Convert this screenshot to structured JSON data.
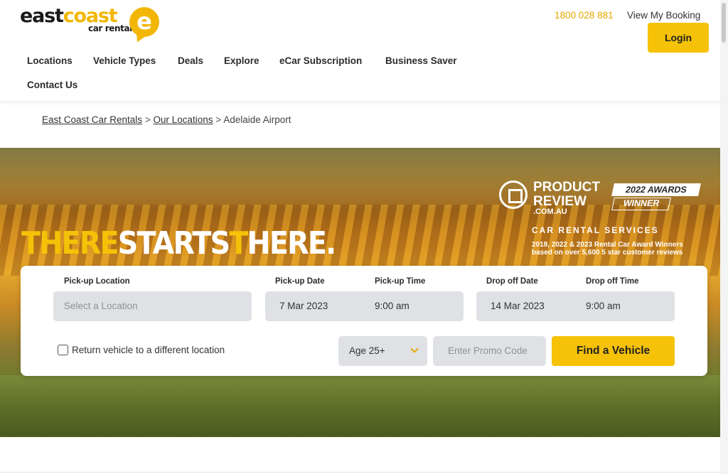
{
  "brand": {
    "logo_east": "east",
    "logo_coast": "coast",
    "logo_sub": "car rentals",
    "logo_e": "e",
    "accent": "#f5c208"
  },
  "header": {
    "phone": "1800 028 881",
    "view_booking": "View My Booking",
    "login_label": "Login"
  },
  "nav": {
    "items": [
      {
        "label": "Locations"
      },
      {
        "label": "Vehicle Types"
      },
      {
        "label": "Deals"
      },
      {
        "label": "Explore"
      },
      {
        "label": "eCar Subscription"
      },
      {
        "label": "Business Saver"
      },
      {
        "label": "Contact Us"
      }
    ]
  },
  "breadcrumb": {
    "items": [
      "East Coast Car Rentals",
      "Our Locations",
      "Adelaide Airport"
    ],
    "separator": ">"
  },
  "hero": {
    "tagline_part1": "THERE",
    "tagline_part2": "STARTS",
    "tagline_part3": "T",
    "tagline_part4": "HERE."
  },
  "award": {
    "title_line1": "PRODUCT",
    "title_line2": "REVIEW",
    "domain": ".COM.AU",
    "year_badge": "2022 AWARDS",
    "winner_badge": "WINNER",
    "service": "CAR RENTAL SERVICES",
    "desc_line1": "2018, 2022 & 2023 Rental Car Award Winners",
    "desc_line2": "based on over 5,600 5 star customer reviews"
  },
  "booking": {
    "pickup_location_label": "Pick-up Location",
    "pickup_location_placeholder": "Select a Location",
    "pickup_date_label": "Pick-up Date",
    "pickup_date_value": "7 Mar 2023",
    "pickup_time_label": "Pick-up Time",
    "pickup_time_value": "9:00 am",
    "dropoff_date_label": "Drop off Date",
    "dropoff_date_value": "14 Mar 2023",
    "dropoff_time_label": "Drop off Time",
    "dropoff_time_value": "9:00 am",
    "return_label": "Return vehicle to a different location",
    "return_checked": false,
    "age_value": "Age 25+",
    "promo_placeholder": "Enter Promo Code",
    "find_label": "Find a Vehicle"
  }
}
